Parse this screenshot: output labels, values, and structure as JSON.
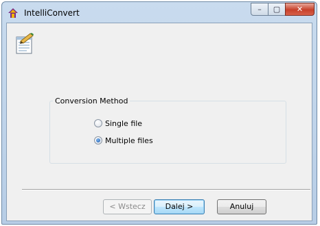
{
  "window": {
    "title": "IntelliConvert",
    "controls": {
      "minimize": "–",
      "maximize": "▢",
      "close": "✕"
    }
  },
  "group": {
    "legend": "Conversion Method",
    "options": [
      {
        "label": "Single file",
        "selected": false
      },
      {
        "label": "Multiple files",
        "selected": true
      }
    ]
  },
  "buttons": {
    "back": "< Wstecz",
    "next": "Dalej >",
    "cancel": "Anuluj"
  },
  "icons": {
    "app": "house-diamond-icon",
    "wizard": "document-pencil-icon"
  },
  "colors": {
    "title_bar": "#c9dbee",
    "close_button": "#c7402a",
    "default_button_border": "#3c7fb1"
  }
}
